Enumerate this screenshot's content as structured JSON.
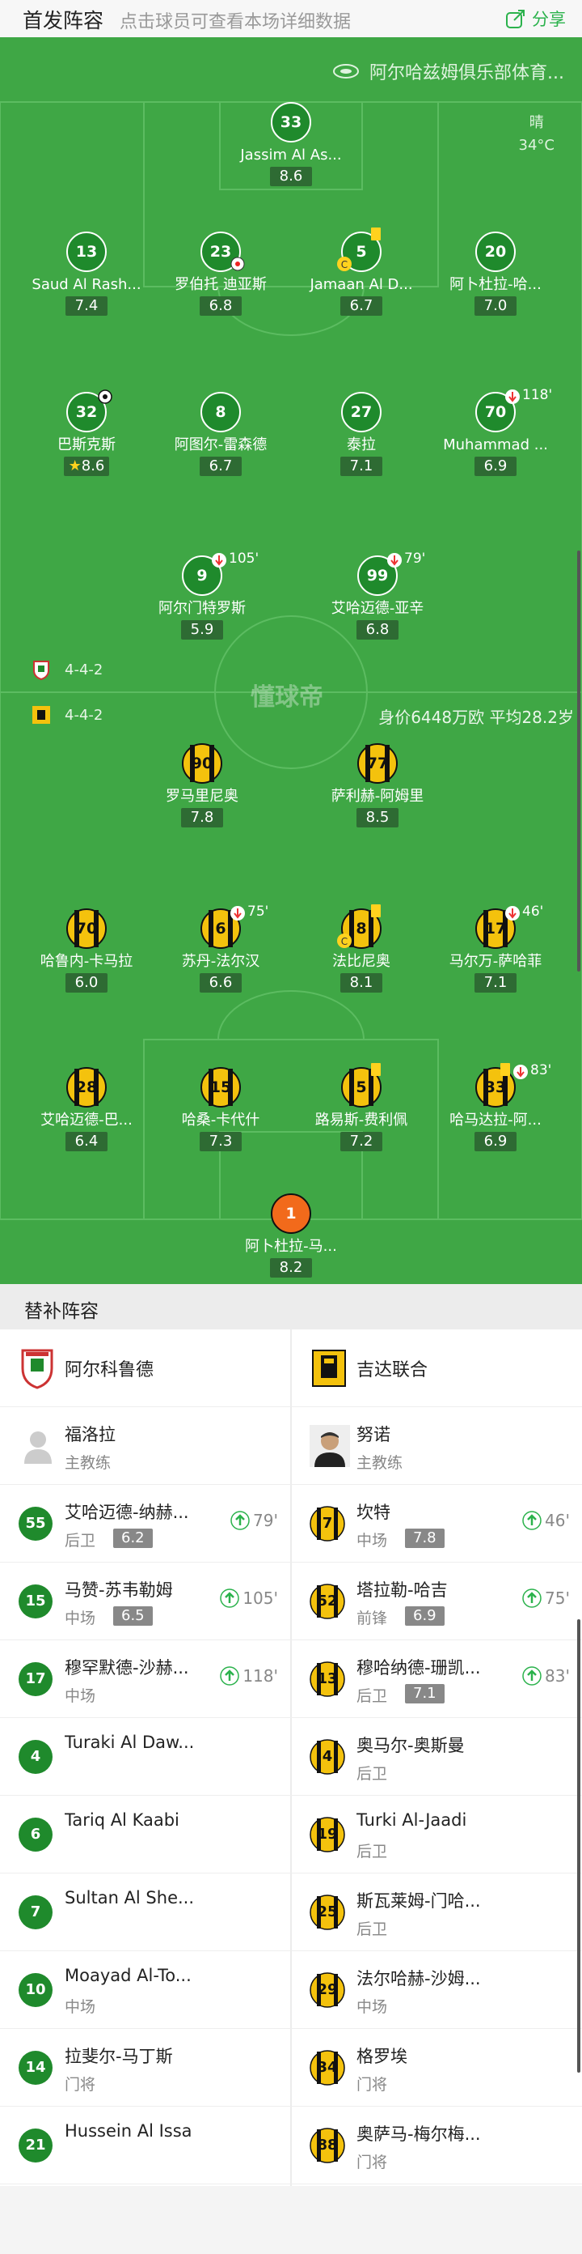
{
  "header": {
    "title": "首发阵容",
    "hint": "点击球员可查看本场详细数据",
    "share": "分享"
  },
  "pitch": {
    "stadium": "阿尔哈兹姆俱乐部体育...",
    "weather": "晴",
    "temperature": "34°C",
    "watermark": "懂球帝",
    "home_formation": "4-4-2",
    "away_formation": "4-4-2",
    "team_value": "身价6448万欧 平均28.2岁"
  },
  "home_players": [
    {
      "num": "33",
      "name": "Jassim Al As...",
      "rating": "8.6"
    },
    {
      "num": "13",
      "name": "Saud Al Rash...",
      "rating": "7.4"
    },
    {
      "num": "23",
      "name": "罗伯托 迪亚斯",
      "rating": "6.8"
    },
    {
      "num": "5",
      "name": "Jamaan Al D...",
      "rating": "6.7"
    },
    {
      "num": "20",
      "name": "阿卜杜拉-哈...",
      "rating": "7.0"
    },
    {
      "num": "32",
      "name": "巴斯克斯",
      "rating": "8.6"
    },
    {
      "num": "8",
      "name": "阿图尔-雷森德",
      "rating": "6.7"
    },
    {
      "num": "27",
      "name": "泰拉",
      "rating": "7.1"
    },
    {
      "num": "70",
      "name": "Muhammad ...",
      "rating": "6.9",
      "sub": "118'"
    },
    {
      "num": "9",
      "name": "阿尔门特罗斯",
      "rating": "5.9",
      "sub": "105'"
    },
    {
      "num": "99",
      "name": "艾哈迈德-亚辛",
      "rating": "6.8",
      "sub": "79'"
    }
  ],
  "away_players": [
    {
      "num": "90",
      "name": "罗马里尼奥",
      "rating": "7.8"
    },
    {
      "num": "77",
      "name": "萨利赫-阿姆里",
      "rating": "8.5"
    },
    {
      "num": "70",
      "name": "哈鲁内-卡马拉",
      "rating": "6.0"
    },
    {
      "num": "6",
      "name": "苏丹-法尔汉",
      "rating": "6.6",
      "sub": "75'"
    },
    {
      "num": "8",
      "name": "法比尼奥",
      "rating": "8.1"
    },
    {
      "num": "17",
      "name": "马尔万-萨哈菲",
      "rating": "7.1",
      "sub": "46'"
    },
    {
      "num": "28",
      "name": "艾哈迈德-巴...",
      "rating": "6.4"
    },
    {
      "num": "15",
      "name": "哈桑-卡代什",
      "rating": "7.3"
    },
    {
      "num": "5",
      "name": "路易斯-费利佩",
      "rating": "7.2"
    },
    {
      "num": "33",
      "name": "哈马达拉-阿...",
      "rating": "6.9",
      "sub": "83'"
    },
    {
      "num": "1",
      "name": "阿卜杜拉-马...",
      "rating": "8.2"
    }
  ],
  "bench": {
    "title": "替补阵容",
    "home_team": "阿尔科鲁德",
    "away_team": "吉达联合",
    "home_coach": {
      "name": "福洛拉",
      "role": "主教练"
    },
    "away_coach": {
      "name": "努诺",
      "role": "主教练"
    },
    "home": [
      {
        "num": "55",
        "name": "艾哈迈德-纳赫...",
        "pos": "后卫",
        "rating": "6.2",
        "sub": "79'"
      },
      {
        "num": "15",
        "name": "马赞-苏韦勒姆",
        "pos": "中场",
        "rating": "6.5",
        "sub": "105'"
      },
      {
        "num": "17",
        "name": "穆罕默德-沙赫...",
        "pos": "中场",
        "rating": "",
        "sub": "118'"
      },
      {
        "num": "4",
        "name": "Turaki Al Daw...",
        "pos": "",
        "rating": "",
        "sub": ""
      },
      {
        "num": "6",
        "name": "Tariq Al Kaabi",
        "pos": "",
        "rating": "",
        "sub": ""
      },
      {
        "num": "7",
        "name": "Sultan Al She...",
        "pos": "",
        "rating": "",
        "sub": ""
      },
      {
        "num": "10",
        "name": "Moayad Al-To...",
        "pos": "中场",
        "rating": "",
        "sub": ""
      },
      {
        "num": "14",
        "name": "拉斐尔-马丁斯",
        "pos": "门将",
        "rating": "",
        "sub": ""
      },
      {
        "num": "21",
        "name": "Hussein Al Issa",
        "pos": "",
        "rating": "",
        "sub": ""
      }
    ],
    "away": [
      {
        "num": "7",
        "name": "坎特",
        "pos": "中场",
        "rating": "7.8",
        "sub": "46'"
      },
      {
        "num": "52",
        "name": "塔拉勒-哈吉",
        "pos": "前锋",
        "rating": "6.9",
        "sub": "75'"
      },
      {
        "num": "13",
        "name": "穆哈纳德-珊凯...",
        "pos": "后卫",
        "rating": "7.1",
        "sub": "83'"
      },
      {
        "num": "4",
        "name": "奥马尔-奥斯曼",
        "pos": "后卫",
        "rating": "",
        "sub": ""
      },
      {
        "num": "19",
        "name": "Turki Al-Jaadi",
        "pos": "后卫",
        "rating": "",
        "sub": ""
      },
      {
        "num": "25",
        "name": "斯瓦莱姆-门哈...",
        "pos": "后卫",
        "rating": "",
        "sub": ""
      },
      {
        "num": "29",
        "name": "法尔哈赫-沙姆...",
        "pos": "中场",
        "rating": "",
        "sub": ""
      },
      {
        "num": "34",
        "name": "格罗埃",
        "pos": "门将",
        "rating": "",
        "sub": ""
      },
      {
        "num": "88",
        "name": "奥萨马-梅尔梅...",
        "pos": "门将",
        "rating": "",
        "sub": ""
      }
    ]
  },
  "colors": {
    "pitch": "#3fa745",
    "home_kit": "#1f8a2c",
    "away_kit": "#f4c20d",
    "gk_kit": "#f26a1b",
    "accent": "#2bb24c"
  }
}
